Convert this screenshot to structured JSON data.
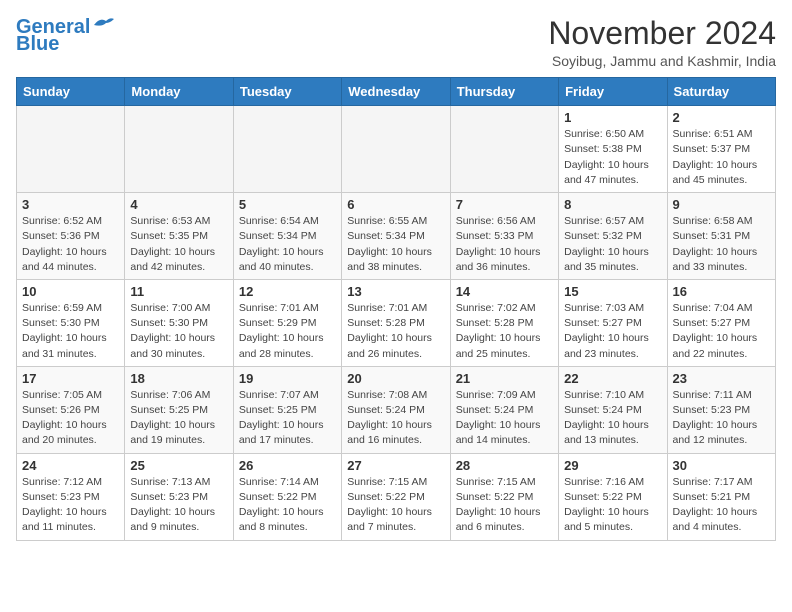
{
  "header": {
    "logo_line1": "General",
    "logo_line2": "Blue",
    "month_title": "November 2024",
    "subtitle": "Soyibug, Jammu and Kashmir, India"
  },
  "days_of_week": [
    "Sunday",
    "Monday",
    "Tuesday",
    "Wednesday",
    "Thursday",
    "Friday",
    "Saturday"
  ],
  "weeks": [
    [
      {
        "day": "",
        "empty": true
      },
      {
        "day": "",
        "empty": true
      },
      {
        "day": "",
        "empty": true
      },
      {
        "day": "",
        "empty": true
      },
      {
        "day": "",
        "empty": true
      },
      {
        "day": "1",
        "sunrise": "Sunrise: 6:50 AM",
        "sunset": "Sunset: 5:38 PM",
        "daylight": "Daylight: 10 hours and 47 minutes."
      },
      {
        "day": "2",
        "sunrise": "Sunrise: 6:51 AM",
        "sunset": "Sunset: 5:37 PM",
        "daylight": "Daylight: 10 hours and 45 minutes."
      }
    ],
    [
      {
        "day": "3",
        "sunrise": "Sunrise: 6:52 AM",
        "sunset": "Sunset: 5:36 PM",
        "daylight": "Daylight: 10 hours and 44 minutes."
      },
      {
        "day": "4",
        "sunrise": "Sunrise: 6:53 AM",
        "sunset": "Sunset: 5:35 PM",
        "daylight": "Daylight: 10 hours and 42 minutes."
      },
      {
        "day": "5",
        "sunrise": "Sunrise: 6:54 AM",
        "sunset": "Sunset: 5:34 PM",
        "daylight": "Daylight: 10 hours and 40 minutes."
      },
      {
        "day": "6",
        "sunrise": "Sunrise: 6:55 AM",
        "sunset": "Sunset: 5:34 PM",
        "daylight": "Daylight: 10 hours and 38 minutes."
      },
      {
        "day": "7",
        "sunrise": "Sunrise: 6:56 AM",
        "sunset": "Sunset: 5:33 PM",
        "daylight": "Daylight: 10 hours and 36 minutes."
      },
      {
        "day": "8",
        "sunrise": "Sunrise: 6:57 AM",
        "sunset": "Sunset: 5:32 PM",
        "daylight": "Daylight: 10 hours and 35 minutes."
      },
      {
        "day": "9",
        "sunrise": "Sunrise: 6:58 AM",
        "sunset": "Sunset: 5:31 PM",
        "daylight": "Daylight: 10 hours and 33 minutes."
      }
    ],
    [
      {
        "day": "10",
        "sunrise": "Sunrise: 6:59 AM",
        "sunset": "Sunset: 5:30 PM",
        "daylight": "Daylight: 10 hours and 31 minutes."
      },
      {
        "day": "11",
        "sunrise": "Sunrise: 7:00 AM",
        "sunset": "Sunset: 5:30 PM",
        "daylight": "Daylight: 10 hours and 30 minutes."
      },
      {
        "day": "12",
        "sunrise": "Sunrise: 7:01 AM",
        "sunset": "Sunset: 5:29 PM",
        "daylight": "Daylight: 10 hours and 28 minutes."
      },
      {
        "day": "13",
        "sunrise": "Sunrise: 7:01 AM",
        "sunset": "Sunset: 5:28 PM",
        "daylight": "Daylight: 10 hours and 26 minutes."
      },
      {
        "day": "14",
        "sunrise": "Sunrise: 7:02 AM",
        "sunset": "Sunset: 5:28 PM",
        "daylight": "Daylight: 10 hours and 25 minutes."
      },
      {
        "day": "15",
        "sunrise": "Sunrise: 7:03 AM",
        "sunset": "Sunset: 5:27 PM",
        "daylight": "Daylight: 10 hours and 23 minutes."
      },
      {
        "day": "16",
        "sunrise": "Sunrise: 7:04 AM",
        "sunset": "Sunset: 5:27 PM",
        "daylight": "Daylight: 10 hours and 22 minutes."
      }
    ],
    [
      {
        "day": "17",
        "sunrise": "Sunrise: 7:05 AM",
        "sunset": "Sunset: 5:26 PM",
        "daylight": "Daylight: 10 hours and 20 minutes."
      },
      {
        "day": "18",
        "sunrise": "Sunrise: 7:06 AM",
        "sunset": "Sunset: 5:25 PM",
        "daylight": "Daylight: 10 hours and 19 minutes."
      },
      {
        "day": "19",
        "sunrise": "Sunrise: 7:07 AM",
        "sunset": "Sunset: 5:25 PM",
        "daylight": "Daylight: 10 hours and 17 minutes."
      },
      {
        "day": "20",
        "sunrise": "Sunrise: 7:08 AM",
        "sunset": "Sunset: 5:24 PM",
        "daylight": "Daylight: 10 hours and 16 minutes."
      },
      {
        "day": "21",
        "sunrise": "Sunrise: 7:09 AM",
        "sunset": "Sunset: 5:24 PM",
        "daylight": "Daylight: 10 hours and 14 minutes."
      },
      {
        "day": "22",
        "sunrise": "Sunrise: 7:10 AM",
        "sunset": "Sunset: 5:24 PM",
        "daylight": "Daylight: 10 hours and 13 minutes."
      },
      {
        "day": "23",
        "sunrise": "Sunrise: 7:11 AM",
        "sunset": "Sunset: 5:23 PM",
        "daylight": "Daylight: 10 hours and 12 minutes."
      }
    ],
    [
      {
        "day": "24",
        "sunrise": "Sunrise: 7:12 AM",
        "sunset": "Sunset: 5:23 PM",
        "daylight": "Daylight: 10 hours and 11 minutes."
      },
      {
        "day": "25",
        "sunrise": "Sunrise: 7:13 AM",
        "sunset": "Sunset: 5:23 PM",
        "daylight": "Daylight: 10 hours and 9 minutes."
      },
      {
        "day": "26",
        "sunrise": "Sunrise: 7:14 AM",
        "sunset": "Sunset: 5:22 PM",
        "daylight": "Daylight: 10 hours and 8 minutes."
      },
      {
        "day": "27",
        "sunrise": "Sunrise: 7:15 AM",
        "sunset": "Sunset: 5:22 PM",
        "daylight": "Daylight: 10 hours and 7 minutes."
      },
      {
        "day": "28",
        "sunrise": "Sunrise: 7:15 AM",
        "sunset": "Sunset: 5:22 PM",
        "daylight": "Daylight: 10 hours and 6 minutes."
      },
      {
        "day": "29",
        "sunrise": "Sunrise: 7:16 AM",
        "sunset": "Sunset: 5:22 PM",
        "daylight": "Daylight: 10 hours and 5 minutes."
      },
      {
        "day": "30",
        "sunrise": "Sunrise: 7:17 AM",
        "sunset": "Sunset: 5:21 PM",
        "daylight": "Daylight: 10 hours and 4 minutes."
      }
    ]
  ]
}
